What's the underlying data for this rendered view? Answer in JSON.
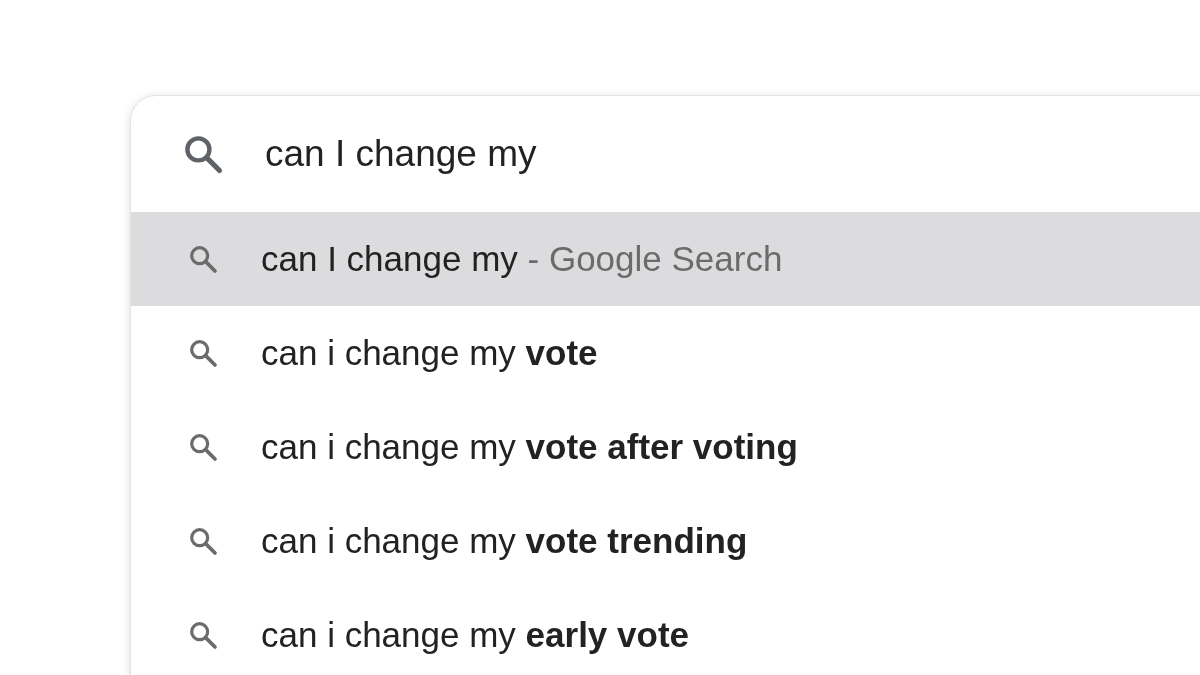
{
  "search": {
    "value": "can I change my"
  },
  "suggestions": [
    {
      "text": "can I change my",
      "suffix": "- Google Search",
      "selected": true
    },
    {
      "text": "can i change my **vote**",
      "selected": false
    },
    {
      "text": "can i change my **vote after voting**",
      "selected": false
    },
    {
      "text": "can i change my **vote trending**",
      "selected": false
    },
    {
      "text": "can i change my **early vote**",
      "selected": false
    }
  ]
}
